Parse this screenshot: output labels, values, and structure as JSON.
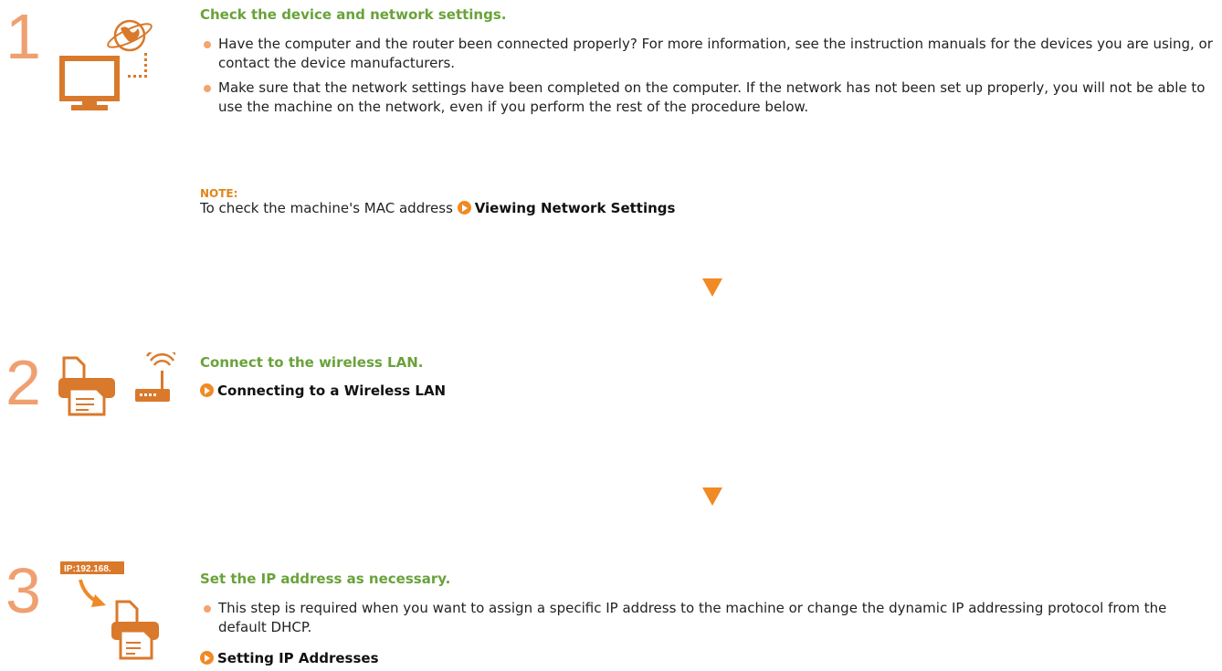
{
  "steps": [
    {
      "number": "1",
      "title": "Check the device and network settings.",
      "bullets": [
        "Have the computer and the router been connected properly? For more information, see the instruction manuals for the devices you are using, or contact the device manufacturers.",
        "Make sure that the network settings have been completed on the computer. If the network has not been set up properly, you will not be able to use the machine on the network, even if you perform the rest of the procedure below."
      ],
      "note_label": "NOTE:",
      "note_text": "To check the machine's MAC address ",
      "note_link": "Viewing Network Settings"
    },
    {
      "number": "2",
      "title": "Connect to the wireless LAN.",
      "link": "Connecting to a Wireless LAN"
    },
    {
      "number": "3",
      "title": "Set the IP address as necessary.",
      "ip_label": "IP:192.168.",
      "bullets": [
        "This step is required when you want to assign a specific IP address to the machine or change the dynamic IP addressing protocol from the default DHCP."
      ],
      "link": "Setting IP Addresses"
    }
  ],
  "colors": {
    "accent": "#f08a24",
    "title_green": "#6aa23a",
    "step_number": "#f0a070",
    "icon": "#d9792b"
  }
}
